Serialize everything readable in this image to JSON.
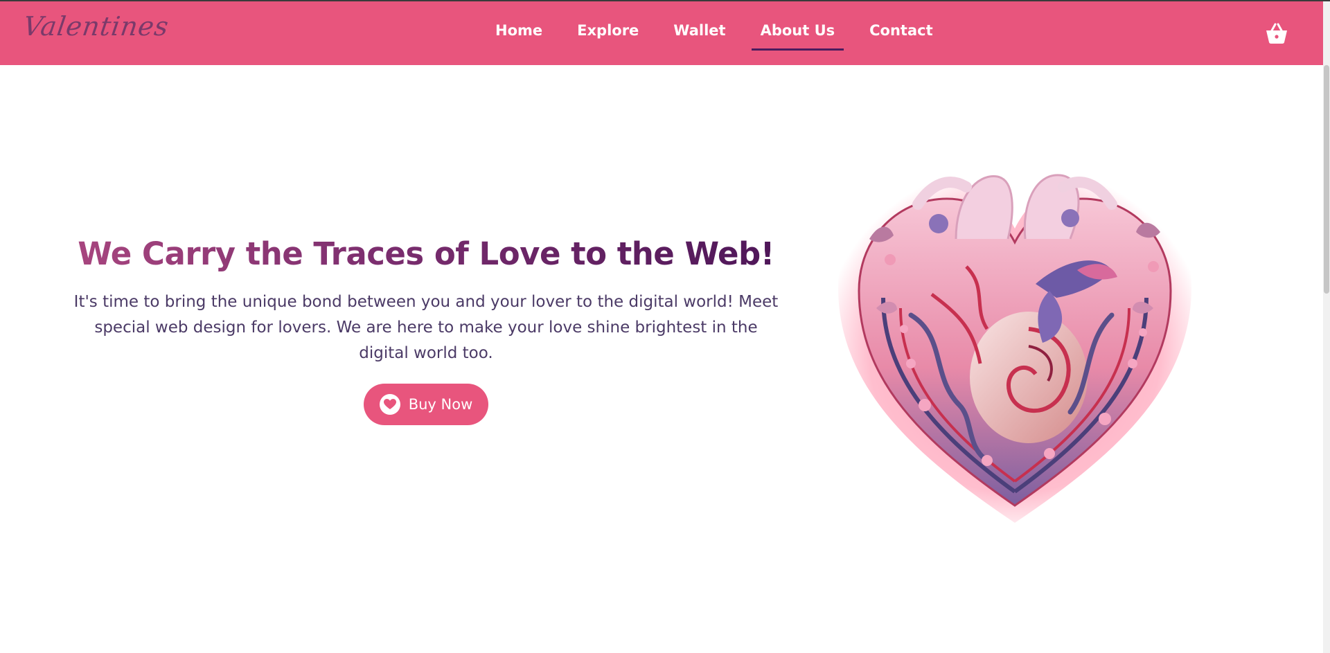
{
  "header": {
    "logo_text": "Valentines",
    "nav": [
      {
        "label": "Home",
        "active": false
      },
      {
        "label": "Explore",
        "active": false
      },
      {
        "label": "Wallet",
        "active": false
      },
      {
        "label": "About Us",
        "active": true
      },
      {
        "label": "Contact",
        "active": false
      }
    ],
    "cart_icon": "basket-icon",
    "background_color": "#e8557d"
  },
  "hero": {
    "title": "We Carry the Traces of Love to the Web!",
    "text": "It's time to bring the unique bond between you and your lover to the digital world! Meet special web design for lovers. We are here to make your love shine brightest in the digital world too.",
    "button_label": "Buy Now",
    "button_icon": "heart-icon",
    "image": "ornate-heart-illustration"
  },
  "colors": {
    "accent": "#e8557d",
    "title_start": "#a9467f",
    "title_end": "#4d1658",
    "body_text": "#4b3a66"
  }
}
